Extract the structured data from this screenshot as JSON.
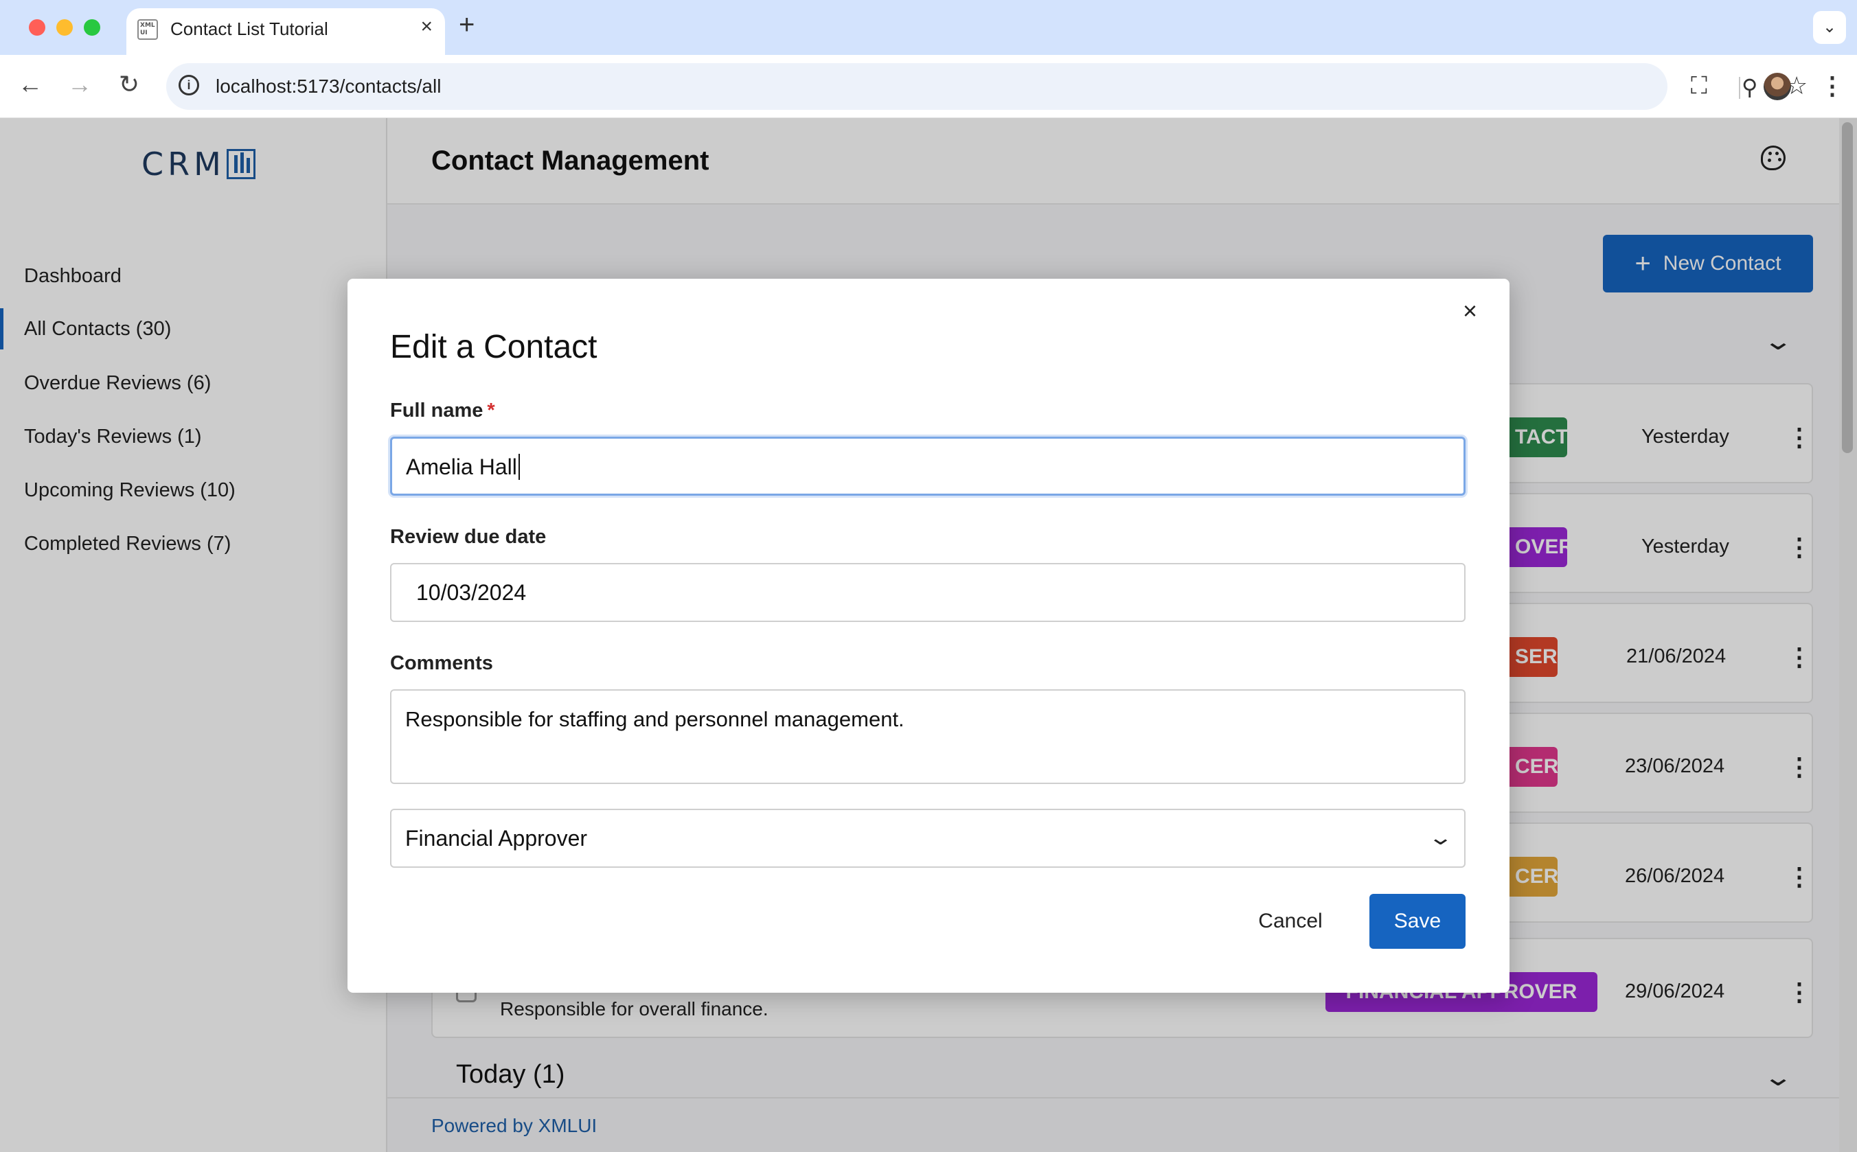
{
  "browser": {
    "tab_title": "Contact List Tutorial",
    "favicon_text": "XML UI",
    "url": "localhost:5173/contacts/all",
    "new_tab_glyph": "+",
    "close_glyph": "×"
  },
  "sidebar": {
    "logo_text": "CRM",
    "items": [
      {
        "label": "Dashboard",
        "active": false
      },
      {
        "label": "All Contacts (30)",
        "active": true
      },
      {
        "label": "Overdue Reviews (6)",
        "active": false
      },
      {
        "label": "Today's Reviews (1)",
        "active": false
      },
      {
        "label": "Upcoming Reviews (10)",
        "active": false
      },
      {
        "label": "Completed Reviews (7)",
        "active": false
      }
    ]
  },
  "header": {
    "title": "Contact Management"
  },
  "main": {
    "new_contact_label": "New Contact",
    "rows": [
      {
        "badge": "TACT",
        "badge_color": "#2e8b4e",
        "date": "Yesterday"
      },
      {
        "badge": "OVER",
        "badge_color": "#9c27d8",
        "date": "Yesterday"
      },
      {
        "badge": "SER",
        "badge_color": "#e0482c",
        "date": "21/06/2024"
      },
      {
        "badge": "CER",
        "badge_color": "#e0388c",
        "date": "23/06/2024"
      },
      {
        "badge": "CER",
        "badge_color": "#e2a63a",
        "date": "26/06/2024"
      },
      {
        "badge": "FINANCIAL APPROVER",
        "badge_color": "#9c27d8",
        "date": "29/06/2024",
        "comment": "Responsible for overall finance."
      }
    ],
    "today_section": "Today (1)",
    "footer": "Powered by XMLUI"
  },
  "modal": {
    "title": "Edit a Contact",
    "full_name_label": "Full name",
    "required_mark": "*",
    "full_name_value": "Amelia Hall",
    "review_date_label": "Review due date",
    "review_date_value": "10/03/2024",
    "comments_label": "Comments",
    "comments_value": "Responsible for staffing and personnel management.",
    "category_value": "Financial Approver",
    "cancel_label": "Cancel",
    "save_label": "Save",
    "close_glyph": "×"
  },
  "colors": {
    "accent": "#1664c0",
    "required": "#d32f2f"
  }
}
